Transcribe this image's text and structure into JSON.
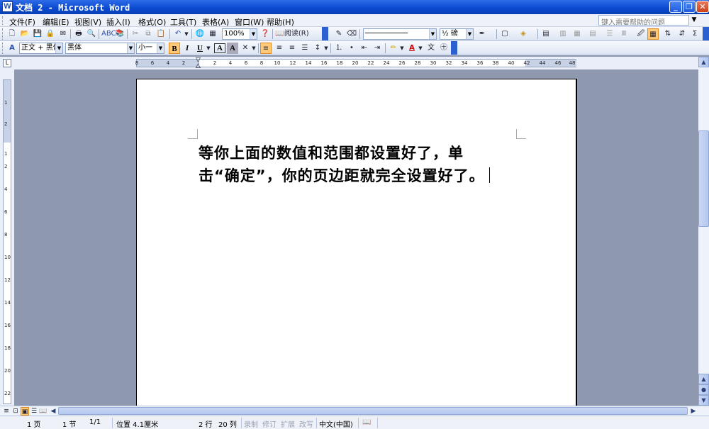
{
  "window": {
    "title": "文档 2 - Microsoft Word",
    "app_icon": "word-doc-icon",
    "controls": [
      "minimize-icon",
      "restore-icon",
      "close-icon"
    ]
  },
  "menubar": {
    "items": [
      {
        "label": "文件(F)"
      },
      {
        "label": "编辑(E)"
      },
      {
        "label": "视图(V)"
      },
      {
        "label": "插入(I)"
      },
      {
        "label": "格式(O)"
      },
      {
        "label": "工具(T)"
      },
      {
        "label": "表格(A)"
      },
      {
        "label": "窗口(W)"
      },
      {
        "label": "帮助(H)"
      }
    ],
    "help_placeholder": "键入需要帮助的问题"
  },
  "standard_toolbar": {
    "zoom": "100%",
    "read_label": "阅读(R)",
    "line_style": "──────────",
    "line_weight": "½ 磅"
  },
  "formatting_toolbar": {
    "style": "正文 + 黑体",
    "font": "黑体",
    "size": "小一",
    "bold": "B",
    "italic": "I",
    "underline": "U",
    "char_border": "A",
    "char_shading": "A"
  },
  "ruler": {
    "ticks": [
      "8",
      "6",
      "4",
      "2",
      "2",
      "4",
      "6",
      "8",
      "10",
      "12",
      "14",
      "16",
      "18",
      "20",
      "22",
      "24",
      "26",
      "28",
      "30",
      "32",
      "34",
      "36",
      "38",
      "40",
      "42",
      "44",
      "46",
      "48"
    ],
    "vticks": [
      "1",
      "2",
      "1",
      "2",
      "4",
      "6",
      "8",
      "10",
      "12",
      "14",
      "16",
      "18",
      "20",
      "22"
    ]
  },
  "document": {
    "line1": "等你上面的数值和范围都设置好了，单",
    "line2": "击“确定”，你的页边距就完全设置好了。"
  },
  "statusbar": {
    "page": "1 页",
    "section": "1 节",
    "pages": "1/1",
    "position": "位置 4.1厘米",
    "line": "2 行",
    "column": "20 列",
    "rec": "录制",
    "trk": "修订",
    "ext": "扩展",
    "ovr": "改写",
    "language": "中文(中国)"
  },
  "colors": {
    "titlebar": "#0A49CF",
    "workspace": "#8E98AE",
    "active_button": "#FFC97A"
  }
}
